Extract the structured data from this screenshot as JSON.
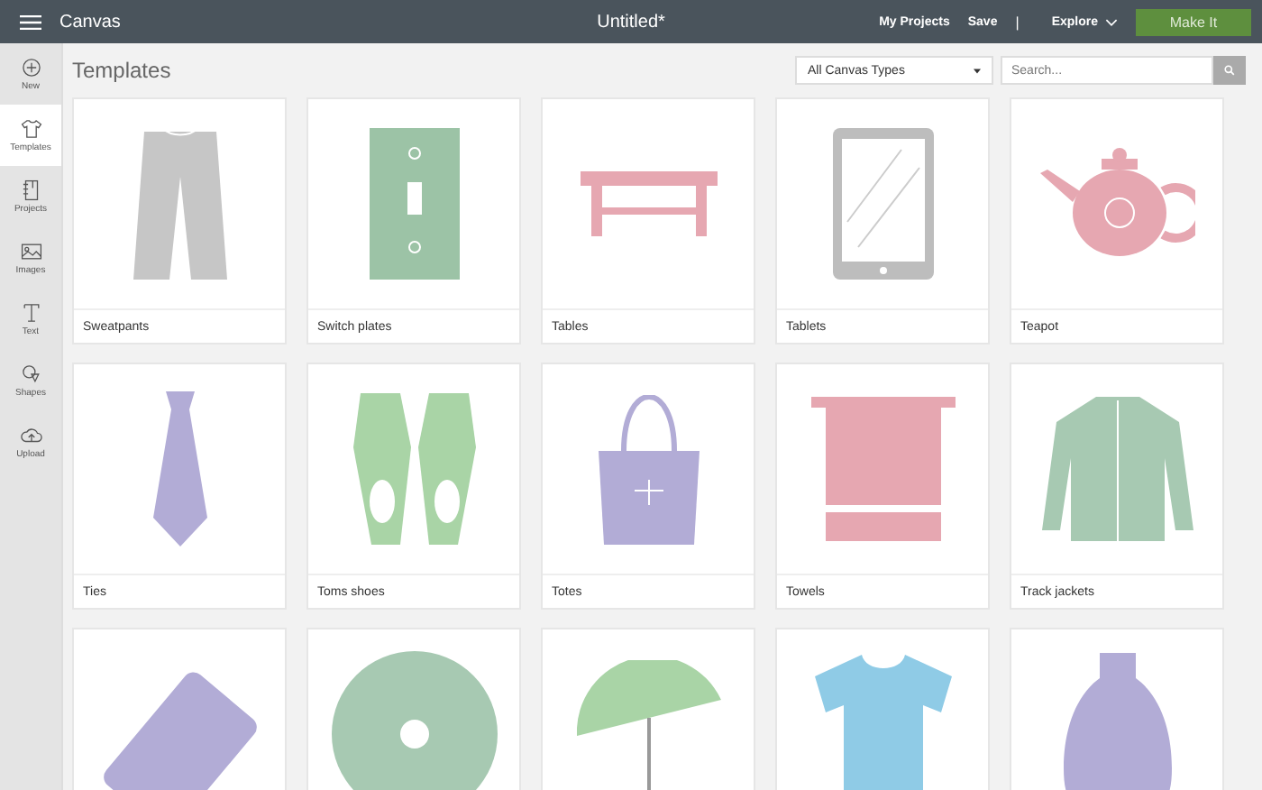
{
  "topbar": {
    "app_name": "Canvas",
    "title": "Untitled*",
    "links": [
      "My Projects",
      "Save"
    ],
    "separator": "|",
    "explore": "Explore",
    "make_button": {
      "label": "Make It",
      "disabled": true
    }
  },
  "sidebar": {
    "items": [
      {
        "label": "New",
        "kind": "plus",
        "selected": false
      },
      {
        "label": "Templates",
        "kind": "shirt",
        "selected": true
      },
      {
        "label": "Projects",
        "kind": "notebook",
        "selected": false
      },
      {
        "label": "Images",
        "kind": "image",
        "selected": false
      },
      {
        "label": "Text",
        "kind": "text",
        "selected": false
      },
      {
        "label": "Shapes",
        "kind": "shapes",
        "selected": false
      },
      {
        "label": "Upload",
        "kind": "upload",
        "selected": false
      }
    ]
  },
  "header": {
    "title": "Templates",
    "filter": "All Canvas Types",
    "search": {
      "placeholder": "Search..."
    }
  },
  "templates": [
    {
      "label": "Sweatpants",
      "kind": "pants",
      "color": "#c6c6c6"
    },
    {
      "label": "Switch plates",
      "kind": "switchplate",
      "color": "#9cc3a6"
    },
    {
      "label": "Tables",
      "kind": "table",
      "color": "#e6a7b1"
    },
    {
      "label": "Tablets",
      "kind": "tablet",
      "color": "#bdbdbd"
    },
    {
      "label": "Teapot",
      "kind": "teapot",
      "color": "#e6a7b1"
    },
    {
      "label": "Ties",
      "kind": "tie",
      "color": "#b2acd6"
    },
    {
      "label": "Toms shoes",
      "kind": "shoes",
      "color": "#a9d4a6"
    },
    {
      "label": "Totes",
      "kind": "tote",
      "color": "#b2acd6"
    },
    {
      "label": "Towels",
      "kind": "towel",
      "color": "#e6a7b1"
    },
    {
      "label": "Track jackets",
      "kind": "jacket",
      "color": "#a7c9b2"
    },
    {
      "kind": "phonecase",
      "color": "#b2acd6"
    },
    {
      "kind": "treeskirt",
      "color": "#a7c9b2"
    },
    {
      "kind": "umbrella",
      "color": "#a9d4a6"
    },
    {
      "kind": "tshirt",
      "color": "#8fcbe6"
    },
    {
      "kind": "vase",
      "color": "#b2acd6"
    }
  ]
}
